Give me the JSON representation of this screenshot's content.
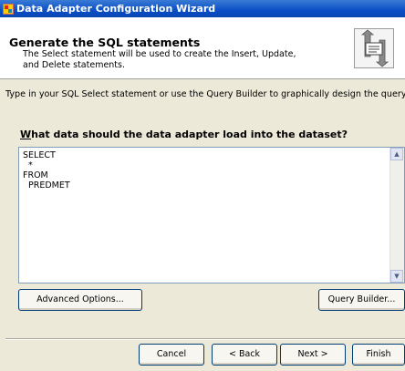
{
  "window": {
    "title": "Data Adapter Configuration Wizard"
  },
  "header": {
    "title": "Generate the SQL statements",
    "description": "The Select statement will be used to create the Insert, Update, and Delete statements."
  },
  "instructions": "Type in your SQL Select statement or use the Query Builder to graphically design the query.",
  "question": {
    "label": "What data should the data adapter load into the dataset?",
    "accesskey": "W",
    "rest": "hat data should the data adapter load into the dataset?"
  },
  "sql": {
    "text": "SELECT\n  *\nFROM\n  PREDMET"
  },
  "buttons": {
    "advanced_options": "Advanced Options...",
    "query_builder": "Query Builder...",
    "cancel": "Cancel",
    "back": "< Back",
    "next": "Next >",
    "finish": "Finish"
  },
  "icons": {
    "app": "wizard-app-icon",
    "header": "sql-generate-icon"
  }
}
